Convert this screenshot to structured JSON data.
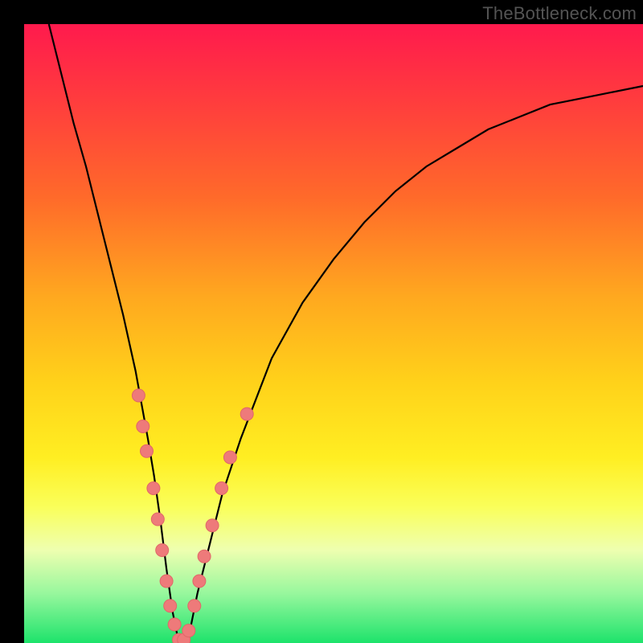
{
  "watermark": "TheBottleneck.com",
  "colors": {
    "frame_bg": "#000000",
    "curve_stroke": "#000000",
    "marker_fill": "#ee7a7a",
    "marker_stroke": "#e06868",
    "gradient_stops": [
      "#ff1a4d",
      "#ff3b3e",
      "#ff6a2a",
      "#ffa81f",
      "#ffd21a",
      "#ffee22",
      "#faff5a",
      "#eeffb0",
      "#97f79d",
      "#1de36b"
    ]
  },
  "chart_data": {
    "type": "line",
    "title": "",
    "xlabel": "",
    "ylabel": "",
    "xlim": [
      0,
      100
    ],
    "ylim": [
      0,
      100
    ],
    "grid": false,
    "series": [
      {
        "name": "bottleneck-curve",
        "x": [
          4,
          6,
          8,
          10,
          12,
          14,
          16,
          18,
          20,
          21,
          22,
          23,
          24,
          25,
          26,
          27,
          28,
          30,
          32,
          35,
          40,
          45,
          50,
          55,
          60,
          65,
          70,
          75,
          80,
          85,
          90,
          95,
          100
        ],
        "y": [
          100,
          92,
          84,
          77,
          69,
          61,
          53,
          44,
          33,
          27,
          20,
          12,
          5,
          0,
          0,
          3,
          8,
          16,
          24,
          33,
          46,
          55,
          62,
          68,
          73,
          77,
          80,
          83,
          85,
          87,
          88,
          89,
          90
        ]
      }
    ],
    "markers": {
      "name": "highlighted-points",
      "points": [
        {
          "x": 18.5,
          "y": 40
        },
        {
          "x": 19.2,
          "y": 35
        },
        {
          "x": 19.8,
          "y": 31
        },
        {
          "x": 20.9,
          "y": 25
        },
        {
          "x": 21.6,
          "y": 20
        },
        {
          "x": 22.3,
          "y": 15
        },
        {
          "x": 23.0,
          "y": 10
        },
        {
          "x": 23.6,
          "y": 6
        },
        {
          "x": 24.3,
          "y": 3
        },
        {
          "x": 25.0,
          "y": 0.5
        },
        {
          "x": 25.8,
          "y": 0.5
        },
        {
          "x": 26.6,
          "y": 2
        },
        {
          "x": 27.5,
          "y": 6
        },
        {
          "x": 28.3,
          "y": 10
        },
        {
          "x": 29.1,
          "y": 14
        },
        {
          "x": 30.4,
          "y": 19
        },
        {
          "x": 31.9,
          "y": 25
        },
        {
          "x": 33.3,
          "y": 30
        },
        {
          "x": 36.0,
          "y": 37
        }
      ]
    }
  }
}
